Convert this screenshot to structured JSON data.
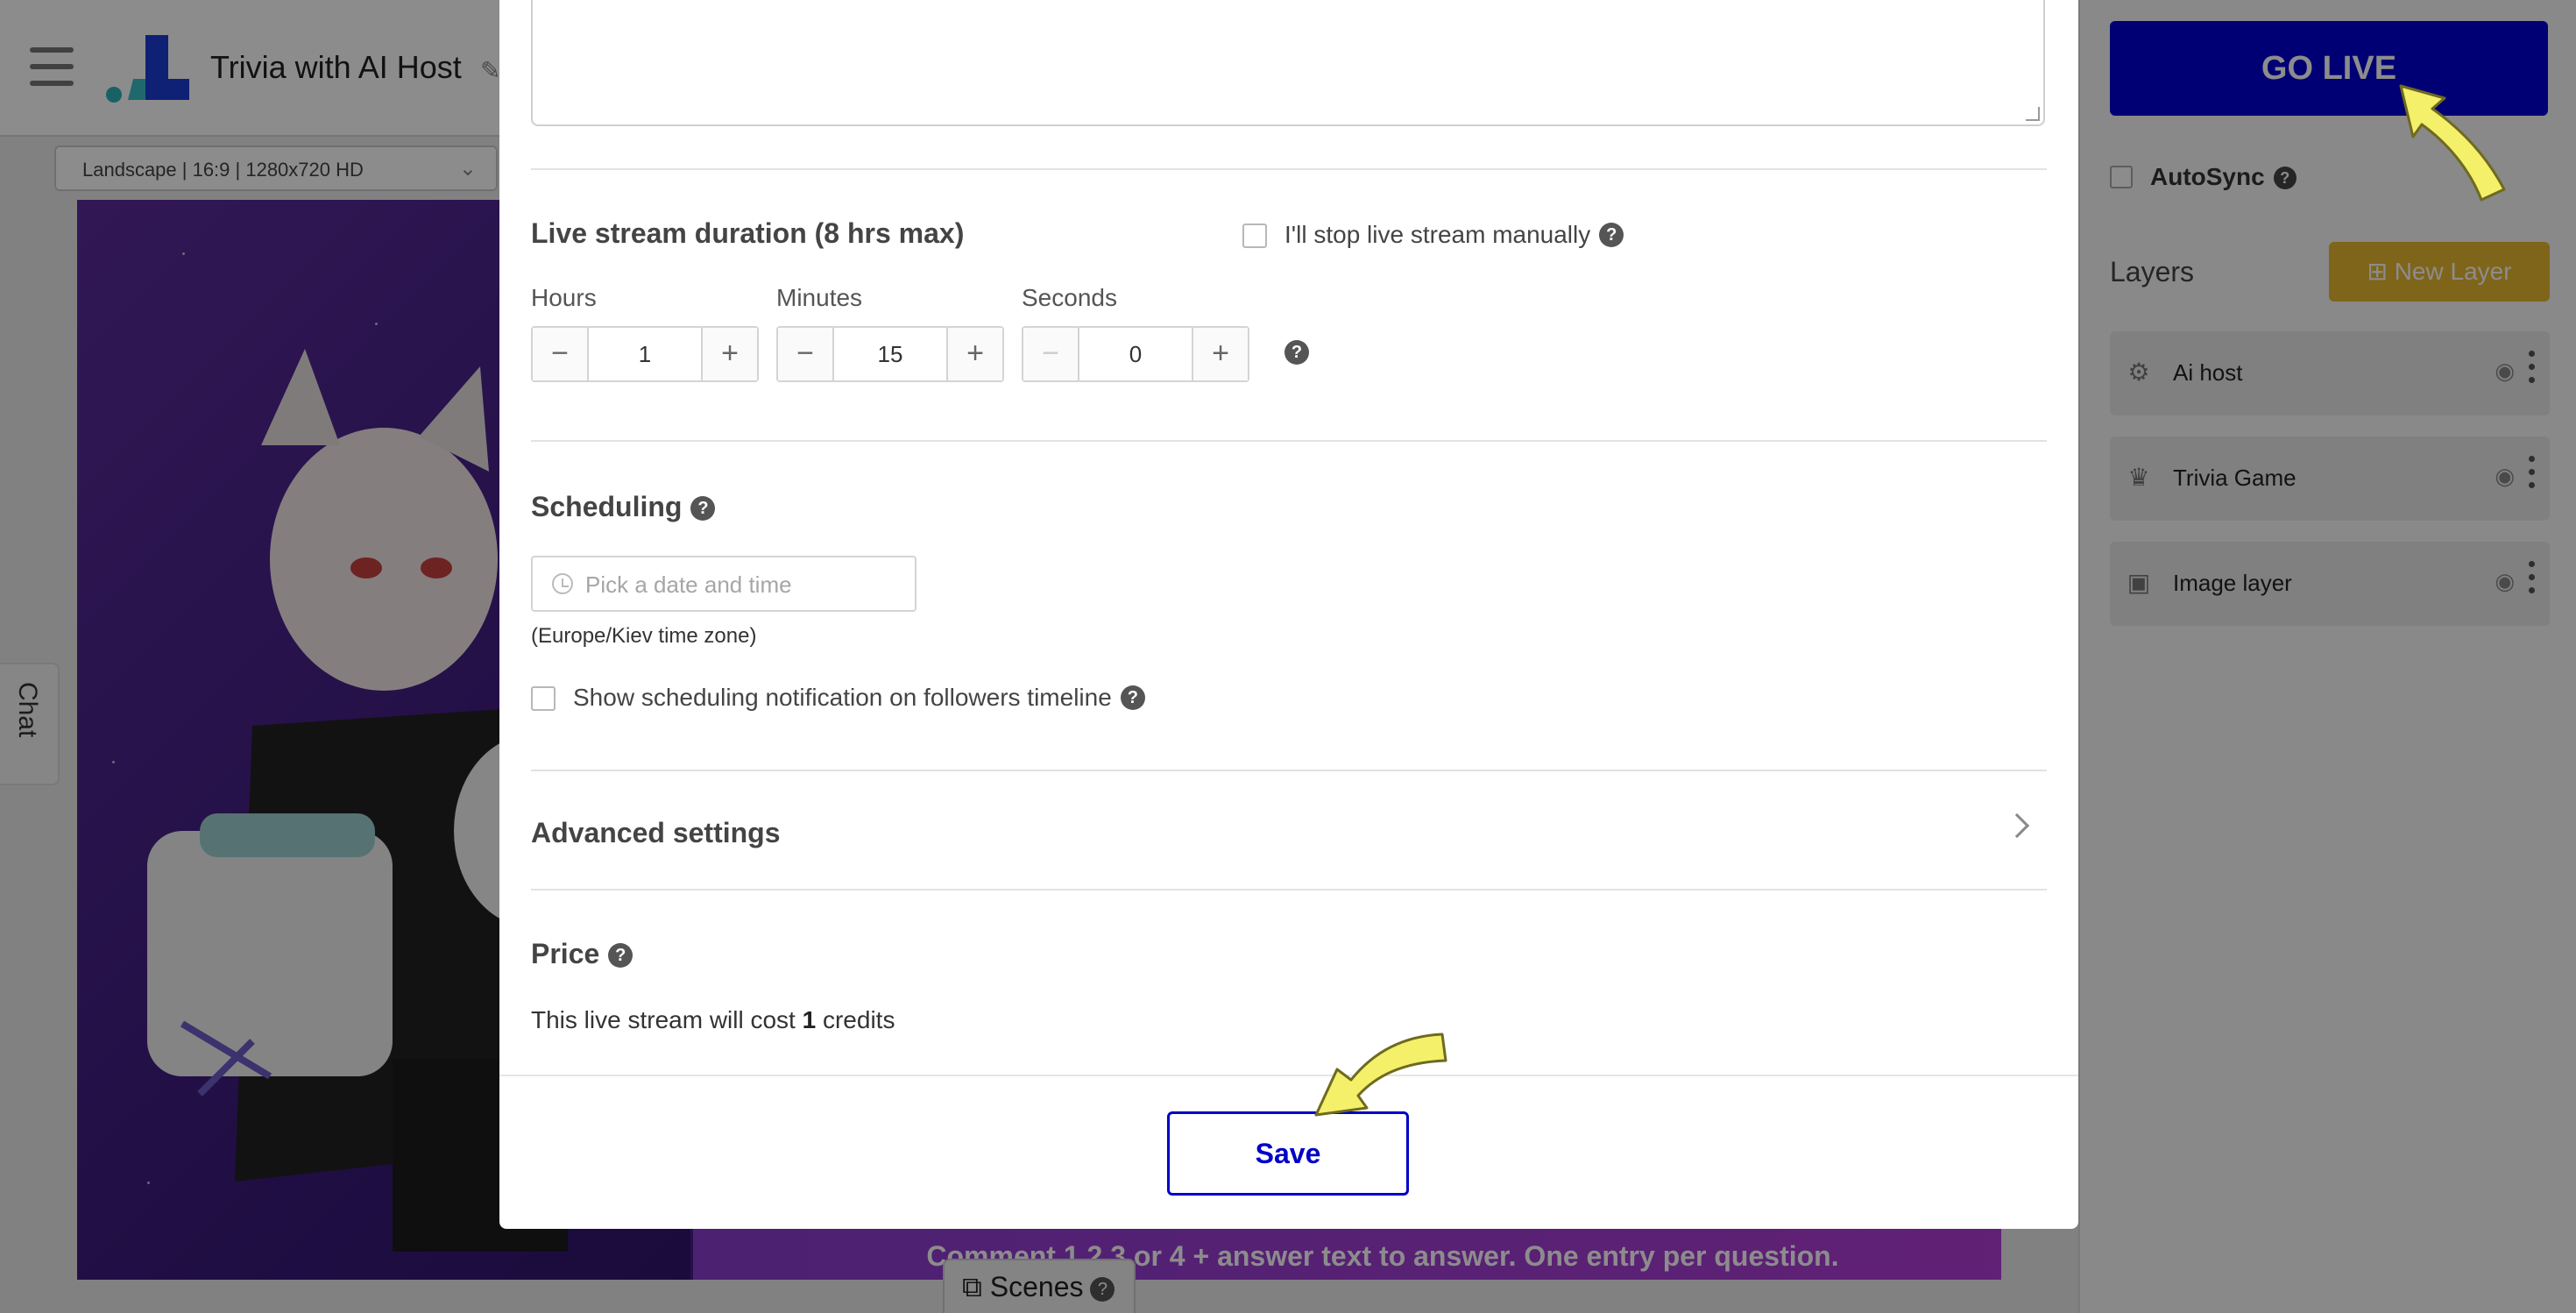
{
  "app": {
    "project_title": "Trivia with AI Host",
    "format_select": "Landscape | 16:9 | 1280x720 HD",
    "banner_text": "Comment 1,2,3 or 4 + answer text to answer. One entry per question.",
    "chat_label": "Chat",
    "scenes_label": "Scenes",
    "help_glyph": "?"
  },
  "right_panel": {
    "go_live_label": "GO LIVE",
    "autosync_label": "AutoSync",
    "layers_title": "Layers",
    "new_layer_label": "New Layer",
    "layers": [
      {
        "name": "Ai host",
        "icon": "robot-icon"
      },
      {
        "name": "Trivia Game",
        "icon": "crown-icon"
      },
      {
        "name": "Image layer",
        "icon": "image-icon"
      }
    ]
  },
  "modal": {
    "duration": {
      "title": "Live stream duration (8 hrs max)",
      "manual_stop_label": "I'll stop live stream manually",
      "hours_label": "Hours",
      "hours_value": "1",
      "minutes_label": "Minutes",
      "minutes_value": "15",
      "seconds_label": "Seconds",
      "seconds_value": "0",
      "minus_glyph": "−",
      "plus_glyph": "+"
    },
    "scheduling": {
      "title": "Scheduling",
      "date_placeholder": "Pick a date and time",
      "timezone_note": "(Europe/Kiev time zone)",
      "notify_label": "Show scheduling notification on followers timeline"
    },
    "advanced_label": "Advanced settings",
    "price": {
      "title": "Price",
      "text_before": "This live stream will cost ",
      "credits": "1",
      "text_after": " credits"
    },
    "save_label": "Save"
  },
  "colors": {
    "accent_blue": "#0000d4",
    "new_layer_gold": "#e8b830",
    "annotation_arrow": "#f5f06a"
  }
}
